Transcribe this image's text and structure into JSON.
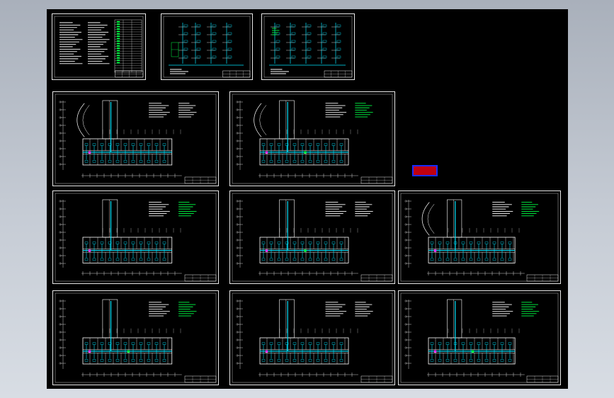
{
  "viewer": {
    "background": "#000000",
    "line_colors": {
      "frame": "#e8e8e8",
      "walls": "#ffffff",
      "cyan": "#00e5ff",
      "green": "#00ff44",
      "magenta": "#ff33ff",
      "blue_stamp": "#1a2cff",
      "red_stamp": "#c00010"
    }
  },
  "sheets": [
    {
      "id": "s1",
      "kind": "notes"
    },
    {
      "id": "s2",
      "kind": "system"
    },
    {
      "id": "s3",
      "kind": "system"
    },
    {
      "id": "s4",
      "kind": "plan-curved"
    },
    {
      "id": "s5",
      "kind": "plan-curved"
    },
    {
      "id": "s6",
      "kind": "plan"
    },
    {
      "id": "s7",
      "kind": "plan"
    },
    {
      "id": "s8",
      "kind": "plan-curved"
    },
    {
      "id": "s9",
      "kind": "plan"
    },
    {
      "id": "s10",
      "kind": "plan"
    },
    {
      "id": "s11",
      "kind": "plan"
    }
  ],
  "marker": {
    "text": ""
  }
}
